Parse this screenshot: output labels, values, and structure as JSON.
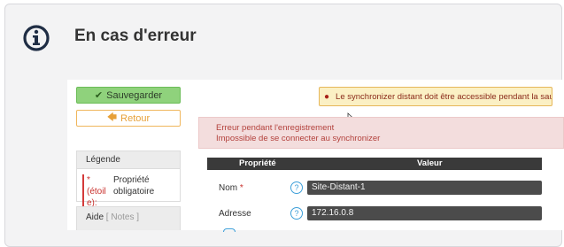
{
  "header": {
    "title": "En cas d'erreur",
    "icon": "info-circle-icon"
  },
  "screenshot": {
    "save_button": {
      "label": "Sauvegarder",
      "icon": "check-icon"
    },
    "back_button": {
      "label": "Retour",
      "icon": "arrow-left-icon"
    },
    "warning": {
      "icon": "comment-icon",
      "text": "Le synchronizer distant doit être accessible pendant la sau..."
    },
    "error": {
      "line1": "Erreur pendant l'enregistrement",
      "line2": "Impossible de se connecter au synchronizer"
    },
    "legend": {
      "title": "Légende",
      "key_line1": "* (étoil",
      "key_line2": "e):",
      "value_line1": "Propriété",
      "value_line2": "obligatoire"
    },
    "aide": {
      "title": "Aide",
      "notes": "[ Notes ]"
    },
    "table": {
      "col_property": "Propriété",
      "col_value": "Valeur",
      "rows": [
        {
          "label": "Nom",
          "required": "*",
          "value": "Site-Distant-1"
        },
        {
          "label": "Adresse",
          "required": "",
          "value": "172.16.0.8"
        }
      ]
    },
    "colors": {
      "save_bg": "#8fd27c",
      "back_border": "#f0b65c",
      "warning_bg": "#fbf0c4",
      "error_bg": "#f3dddd",
      "table_header_bg": "#3a3a3a",
      "input_bg": "#4b4b4b",
      "help_icon": "#3d9fd9"
    }
  }
}
